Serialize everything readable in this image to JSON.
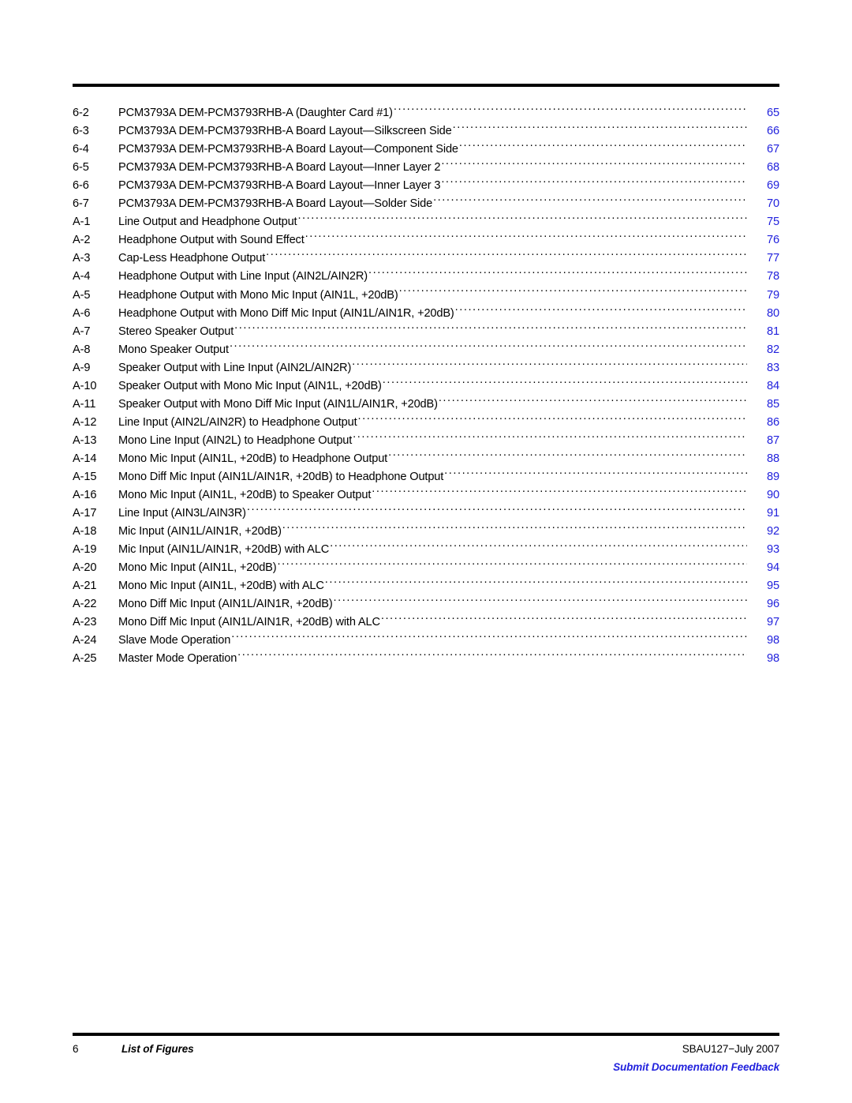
{
  "document": {
    "section_title": "List of Figures",
    "page_number": "6",
    "doc_id": "SBAU127−July 2007",
    "feedback_link": "Submit Documentation Feedback",
    "accent_color": "#2222dd",
    "rule_color": "#000000"
  },
  "figures": [
    {
      "number": "6-2",
      "title": "PCM3793A DEM-PCM3793RHB-A (Daughter Card #1)",
      "page": "65"
    },
    {
      "number": "6-3",
      "title": "PCM3793A DEM-PCM3793RHB-A Board Layout—Silkscreen Side",
      "page": "66"
    },
    {
      "number": "6-4",
      "title": "PCM3793A DEM-PCM3793RHB-A Board Layout—Component Side",
      "page": "67"
    },
    {
      "number": "6-5",
      "title": "PCM3793A DEM-PCM3793RHB-A Board Layout—Inner Layer 2",
      "page": "68"
    },
    {
      "number": "6-6",
      "title": "PCM3793A DEM-PCM3793RHB-A Board Layout—Inner Layer 3",
      "page": "69"
    },
    {
      "number": "6-7",
      "title": "PCM3793A DEM-PCM3793RHB-A Board Layout—Solder Side",
      "page": "70"
    },
    {
      "number": "A-1",
      "title": "Line Output and Headphone Output",
      "page": "75"
    },
    {
      "number": "A-2",
      "title": "Headphone Output with Sound Effect",
      "page": "76"
    },
    {
      "number": "A-3",
      "title": "Cap-Less Headphone Output",
      "page": "77"
    },
    {
      "number": "A-4",
      "title": "Headphone Output with Line Input (AIN2L/AIN2R)",
      "page": "78"
    },
    {
      "number": "A-5",
      "title": "Headphone Output with Mono Mic Input (AIN1L, +20dB)",
      "page": "79"
    },
    {
      "number": "A-6",
      "title": "Headphone Output with Mono Diff Mic Input (AIN1L/AIN1R, +20dB)",
      "page": "80"
    },
    {
      "number": "A-7",
      "title": "Stereo Speaker Output",
      "page": "81"
    },
    {
      "number": "A-8",
      "title": "Mono Speaker Output",
      "page": "82"
    },
    {
      "number": "A-9",
      "title": "Speaker Output with Line Input (AIN2L/AIN2R)",
      "page": "83"
    },
    {
      "number": "A-10",
      "title": "Speaker Output with Mono Mic Input (AIN1L, +20dB)",
      "page": "84"
    },
    {
      "number": "A-11",
      "title": "Speaker Output with Mono Diff Mic Input (AIN1L/AIN1R, +20dB)",
      "page": "85"
    },
    {
      "number": "A-12",
      "title": "Line Input (AIN2L/AIN2R) to Headphone Output",
      "page": "86"
    },
    {
      "number": "A-13",
      "title": "Mono Line Input (AIN2L) to Headphone Output",
      "page": "87"
    },
    {
      "number": "A-14",
      "title": "Mono Mic Input (AIN1L, +20dB) to Headphone Output",
      "page": "88"
    },
    {
      "number": "A-15",
      "title": "Mono Diff Mic Input (AIN1L/AIN1R, +20dB) to Headphone Output",
      "page": "89"
    },
    {
      "number": "A-16",
      "title": "Mono Mic Input (AIN1L, +20dB) to Speaker Output",
      "page": "90"
    },
    {
      "number": "A-17",
      "title": "Line Input (AIN3L/AIN3R)",
      "page": "91"
    },
    {
      "number": "A-18",
      "title": "Mic Input (AIN1L/AIN1R, +20dB)",
      "page": "92"
    },
    {
      "number": "A-19",
      "title": "Mic Input (AIN1L/AIN1R, +20dB) with ALC",
      "page": "93"
    },
    {
      "number": "A-20",
      "title": "Mono Mic Input (AIN1L, +20dB)",
      "page": "94"
    },
    {
      "number": "A-21",
      "title": "Mono Mic Input (AIN1L, +20dB) with ALC",
      "page": "95"
    },
    {
      "number": "A-22",
      "title": "Mono Diff Mic Input (AIN1L/AIN1R, +20dB)",
      "page": "96"
    },
    {
      "number": "A-23",
      "title": "Mono Diff Mic Input (AIN1L/AIN1R, +20dB) with ALC",
      "page": "97"
    },
    {
      "number": "A-24",
      "title": "Slave Mode Operation",
      "page": "98"
    },
    {
      "number": "A-25",
      "title": "Master Mode Operation",
      "page": "98"
    }
  ]
}
